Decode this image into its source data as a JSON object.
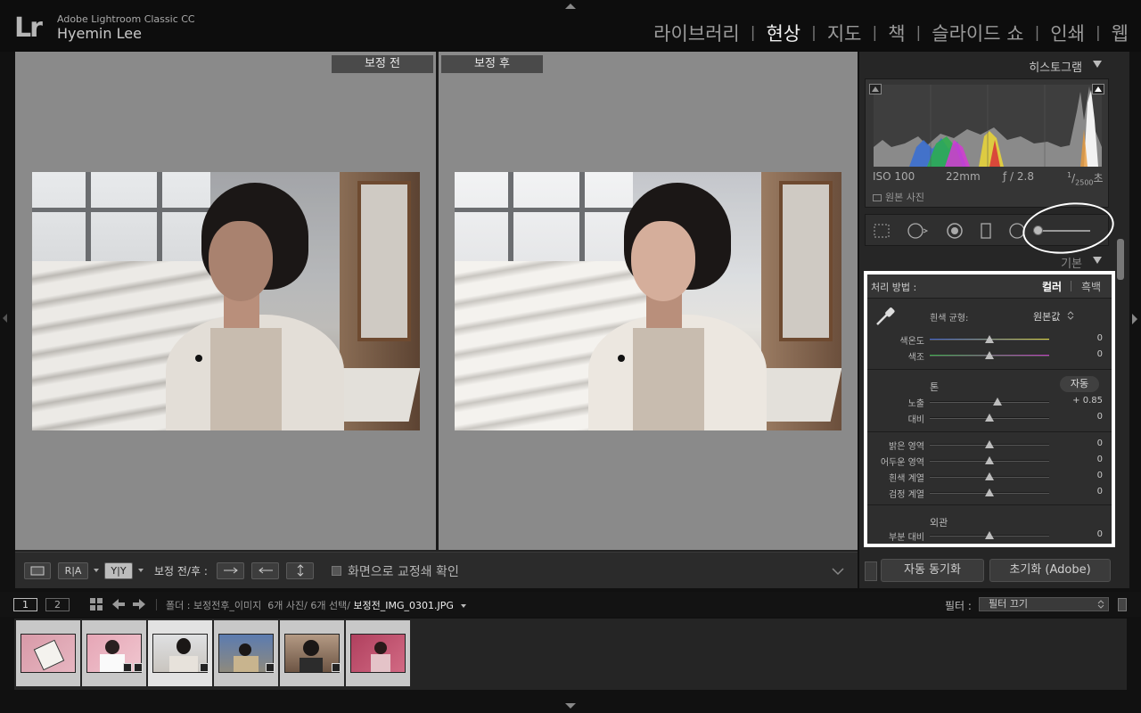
{
  "app": {
    "logo": "Lr",
    "name": "Adobe Lightroom Classic CC",
    "user": "Hyemin Lee"
  },
  "modules": [
    {
      "label": "라이브러리",
      "active": false
    },
    {
      "label": "현상",
      "active": true
    },
    {
      "label": "지도",
      "active": false
    },
    {
      "label": "책",
      "active": false
    },
    {
      "label": "슬라이드 쇼",
      "active": false
    },
    {
      "label": "인쇄",
      "active": false
    },
    {
      "label": "웹",
      "active": false
    }
  ],
  "module_separator": "|",
  "views": {
    "before_label": "보정 전",
    "after_label": "보정 후"
  },
  "toolbar": {
    "ra_label": "R|A",
    "yy_label": "Y|Y",
    "before_after_label": "보정 전/후 :",
    "proof_label": "화면으로 교정쇄 확인"
  },
  "histogram": {
    "title": "히스토그램",
    "iso": "ISO 100",
    "focal": "22mm",
    "aperture": "ƒ / 2.8",
    "shutter_num": "1",
    "shutter_den": "2500",
    "shutter_unit": "초",
    "original_photo": "원본 사진"
  },
  "basic": {
    "title": "기본",
    "treatment_label": "처리 방법 :",
    "color_label": "컬러",
    "bw_label": "흑백",
    "wb_label": "흰색 균형:",
    "wb_value": "원본값",
    "tone_label": "톤",
    "auto_label": "자동",
    "presence_label": "외관",
    "sliders": [
      {
        "id": "temp",
        "label": "색온도",
        "value": "0",
        "pos": 0.5
      },
      {
        "id": "tint",
        "label": "색조",
        "value": "0",
        "pos": 0.5
      },
      {
        "id": "exposure",
        "label": "노출",
        "value": "+ 0.85",
        "pos": 0.57
      },
      {
        "id": "contrast",
        "label": "대비",
        "value": "0",
        "pos": 0.5
      },
      {
        "id": "highlights",
        "label": "밝은 영역",
        "value": "0",
        "pos": 0.5
      },
      {
        "id": "shadows",
        "label": "어두운 영역",
        "value": "0",
        "pos": 0.5
      },
      {
        "id": "whites",
        "label": "흰색 계열",
        "value": "0",
        "pos": 0.5
      },
      {
        "id": "blacks",
        "label": "검정 계열",
        "value": "0",
        "pos": 0.5
      },
      {
        "id": "clarity",
        "label": "부분 대비",
        "value": "0",
        "pos": 0.5
      }
    ]
  },
  "actions": {
    "sync_label": "자동 동기화",
    "reset_label": "초기화 (Adobe)"
  },
  "filmstrip": {
    "page1": "1",
    "page2": "2",
    "folder_prefix": "폴더 : 보정전후_이미지",
    "counts": "6개 사진/ 6개 선택/",
    "filename": "보정전_IMG_0301.JPG",
    "filter_label": "필터 :",
    "filter_value": "필터 끄기"
  },
  "colors": {
    "accent_white": "#ffffff",
    "panel_bg": "#262626",
    "view_bg": "#8a8a8a"
  }
}
